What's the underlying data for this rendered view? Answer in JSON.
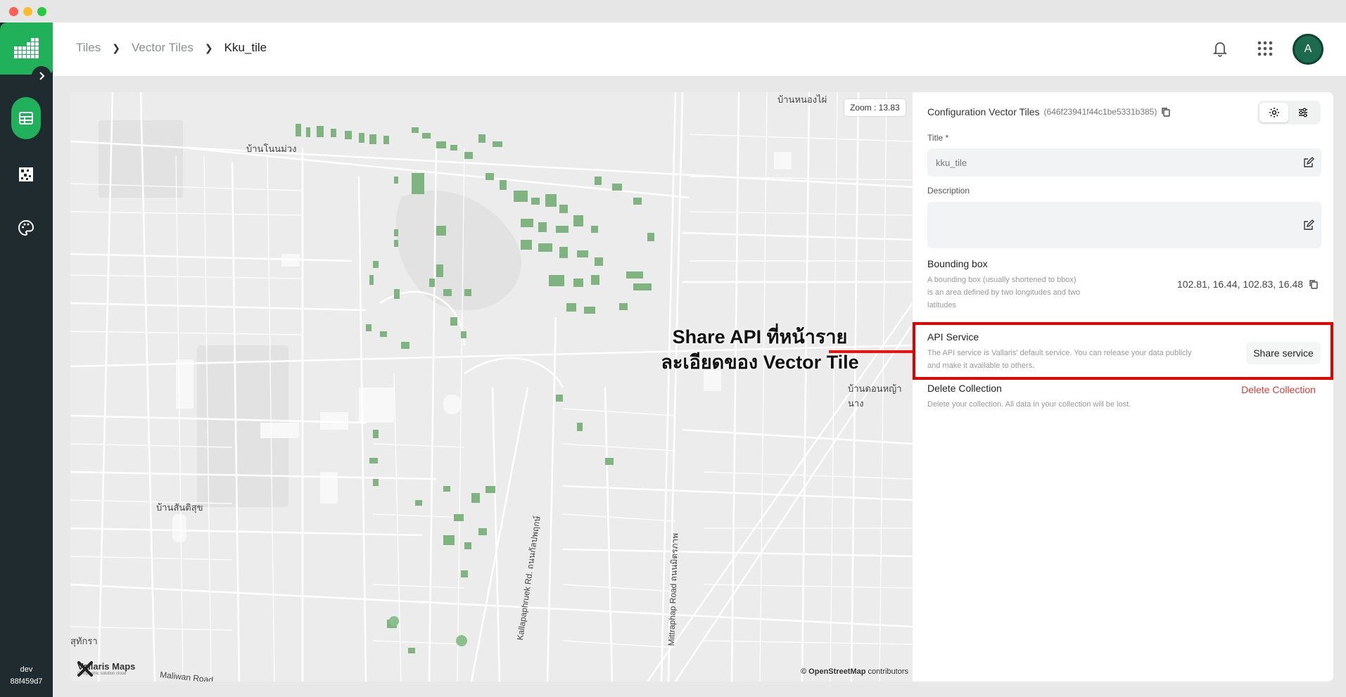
{
  "window": {
    "controls": [
      "close",
      "minimize",
      "maximize"
    ]
  },
  "sidebar": {
    "items": [
      {
        "name": "tables",
        "icon": "table-icon",
        "active": true
      },
      {
        "name": "tiles",
        "icon": "tiles-grid-icon",
        "active": false
      },
      {
        "name": "styles",
        "icon": "palette-icon",
        "active": false
      }
    ],
    "env_label": "dev",
    "version": "88f459d7"
  },
  "breadcrumb": {
    "items": [
      "Tiles",
      "Vector Tiles",
      "Kku_tile"
    ]
  },
  "header": {
    "avatar_initial": "A"
  },
  "map": {
    "zoom_text": "Zoom : 13.83",
    "attribution_owner": "© OpenStreetMap",
    "attribution_suffix": " contributors",
    "logo_name": "Vallaris Maps",
    "logo_tagline": "Geographic solution cloud",
    "places": [
      "บ้านหนองไผ่",
      "บ้านโนนม่วง",
      "บ้านดอนหญ้านาง",
      "บ้านสันติสุข",
      "สุทักรา"
    ],
    "roads": [
      "Kallapaphruek Rd. ถนนกัลปพฤกษ์",
      "Mittraphap Road ถนนมิตรภาพ",
      "Maliwan Road"
    ],
    "callout_line1": "Share API ที่หน้าราย",
    "callout_line2": "ละเอียดของ Vector Tile"
  },
  "panel": {
    "title": "Configuration Vector Tiles",
    "collection_id": "(646f23941f44c1be5331b385)",
    "title_label": "Title *",
    "title_value": "kku_tile",
    "description_label": "Description",
    "description_value": "",
    "bbox_title": "Bounding box",
    "bbox_desc": "A bounding box (usually shortened to bbox) is an area defined by two longitudes and two latitudes",
    "bbox_value": "102.81, 16.44, 102.83, 16.48",
    "api_title": "API Service",
    "api_desc": "The API service is Vallaris' default service. You can release your data publicly and make it available to others.",
    "share_button": "Share service",
    "delete_title": "Delete Collection",
    "delete_desc": "Delete your collection. All data in your collection will be lost.",
    "delete_button": "Delete Collection"
  },
  "colors": {
    "brand_green": "#20b15a",
    "sidebar_dark": "#1f2b2e",
    "highlight_red": "#e50000",
    "danger": "#e53935"
  }
}
